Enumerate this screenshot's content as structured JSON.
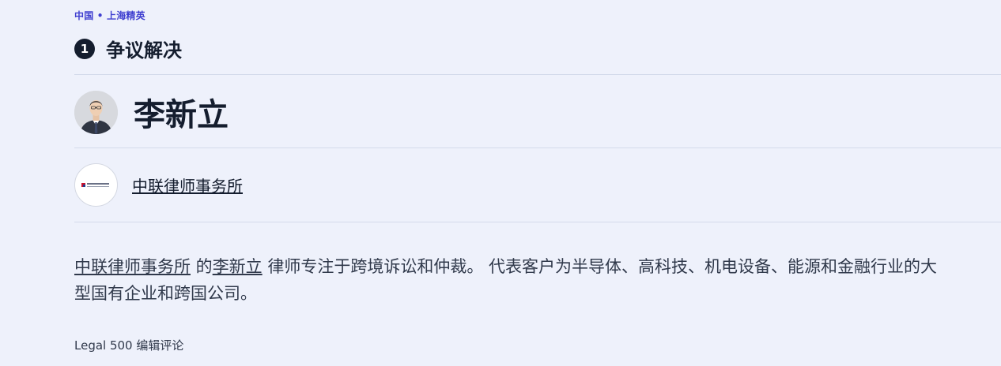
{
  "breadcrumb": "中国 • 上海精英",
  "ranking": {
    "number": "1",
    "practice_area": "争议解决"
  },
  "lawyer": {
    "name": "李新立"
  },
  "firm": {
    "name": "中联律师事务所",
    "logo_text": "中联律师事务所"
  },
  "description": {
    "firm": "中联律师事务所",
    "connector": " 的",
    "lawyer": "李新立",
    "body": " 律师专注于跨境诉讼和仲裁。 代表客户为半导体、高科技、机电设备、能源和金融行业的大型国有企业和跨国公司。"
  },
  "source_label": "Legal 500 编辑评论",
  "colors": {
    "background": "#eef1fb",
    "breadcrumb": "#3f3fd0",
    "heading": "#141d2e",
    "divider": "#d3daea",
    "logo_red": "#c8102e",
    "logo_blue": "#1f3f8f"
  }
}
